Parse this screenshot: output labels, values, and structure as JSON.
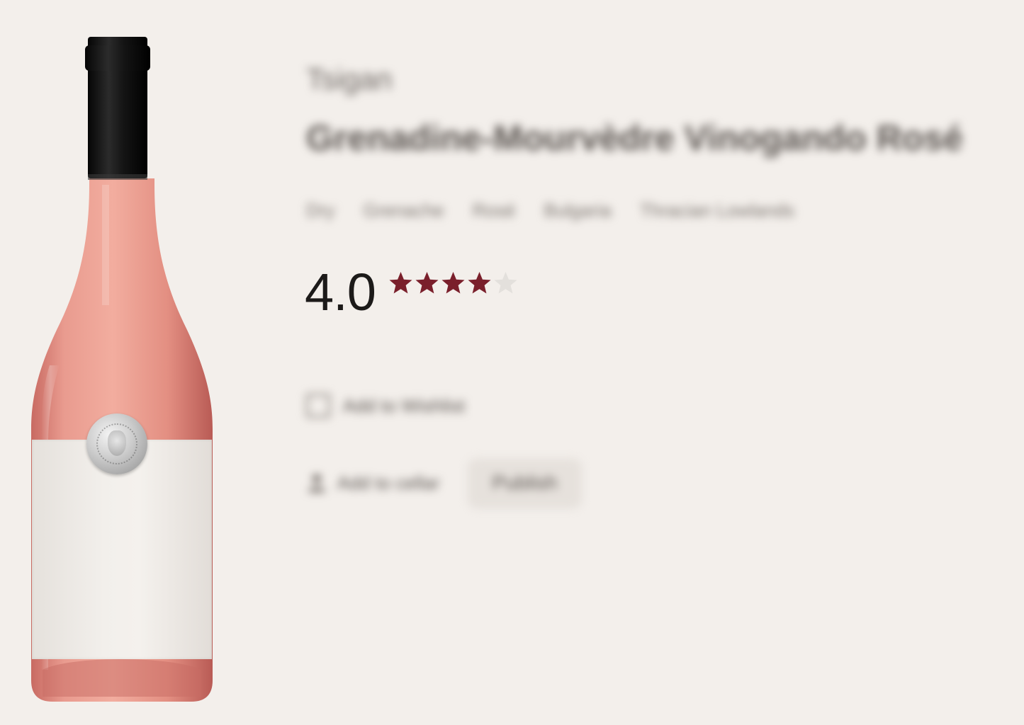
{
  "product": {
    "producer": "Tsigan",
    "name": "Grenadine-Mourvèdre Vinogando Rosé",
    "tags": [
      "Dry",
      "Grenache",
      "Rosé",
      "Bulgaria",
      "Thracian Lowlands"
    ]
  },
  "rating": {
    "value": "4.0",
    "stars_filled": 4,
    "stars_total": 5,
    "star_color": "#7a1f2b",
    "star_empty_color": "#e3e0dc"
  },
  "actions": {
    "wishlist_label": "Add to Wishlist",
    "cellar_label": "Add to cellar",
    "publish_label": "Publish"
  },
  "colors": {
    "background": "#f3efeb",
    "rose_wine": "#e7998c",
    "capsule": "#111111"
  }
}
